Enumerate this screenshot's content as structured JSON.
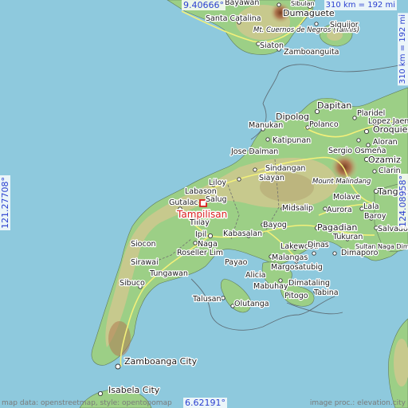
{
  "map": {
    "selected_place": "Tampilisan",
    "coordinates": {
      "top_lat": "9.40666°",
      "bottom_lat": "6.62191°",
      "left_lon": "121.27708°",
      "right_lon": "124.08958°"
    },
    "scale": {
      "horizontal": "310 km = 192 mi",
      "vertical": "310 km = 192 mi"
    },
    "credits": {
      "left": "map data: openstreetmap, style: opentopomap",
      "right": "image proc.: elevation.city"
    },
    "colors": {
      "water": "#8ec9dd",
      "lowland": "#9ccf86",
      "upland": "#c7c98d",
      "highland": "#b07a52",
      "road": "#f3f07a",
      "border": "#6f6f6f",
      "marker": "#d81e1e",
      "coord_text": "#2a3fd0"
    },
    "places": [
      {
        "name": "Bayawan",
        "kind": "town"
      },
      {
        "name": "Sibulan",
        "kind": "town"
      },
      {
        "name": "Dumaguete",
        "kind": "city"
      },
      {
        "name": "Santa Catalina",
        "kind": "town"
      },
      {
        "name": "Mt. Cuernos de Negros (Talinis)",
        "kind": "peak"
      },
      {
        "name": "Siquijor",
        "kind": "town"
      },
      {
        "name": "Siaton",
        "kind": "town"
      },
      {
        "name": "Zamboanguita",
        "kind": "town"
      },
      {
        "name": "Dapitan",
        "kind": "city"
      },
      {
        "name": "Dipolog",
        "kind": "city"
      },
      {
        "name": "Polanco",
        "kind": "town"
      },
      {
        "name": "Plaridel",
        "kind": "town"
      },
      {
        "name": "Lopez Jaena",
        "kind": "town"
      },
      {
        "name": "Oroquieta",
        "kind": "city"
      },
      {
        "name": "Manukan",
        "kind": "town"
      },
      {
        "name": "Katipunan",
        "kind": "town"
      },
      {
        "name": "Sergio Osmeña",
        "kind": "town"
      },
      {
        "name": "Aloran",
        "kind": "town"
      },
      {
        "name": "Jose Dalman",
        "kind": "town"
      },
      {
        "name": "Ozamiz",
        "kind": "city"
      },
      {
        "name": "Clarin",
        "kind": "town"
      },
      {
        "name": "Sindangan",
        "kind": "town"
      },
      {
        "name": "Siayan",
        "kind": "town"
      },
      {
        "name": "Mount Malindang",
        "kind": "peak"
      },
      {
        "name": "Tangub",
        "kind": "city"
      },
      {
        "name": "Liloy",
        "kind": "town"
      },
      {
        "name": "Labason",
        "kind": "town"
      },
      {
        "name": "Salug",
        "kind": "town"
      },
      {
        "name": "Gutalac",
        "kind": "town"
      },
      {
        "name": "Tillay",
        "kind": "town"
      },
      {
        "name": "Midsalip",
        "kind": "town"
      },
      {
        "name": "Molave",
        "kind": "town"
      },
      {
        "name": "Aurora",
        "kind": "town"
      },
      {
        "name": "Lala",
        "kind": "town"
      },
      {
        "name": "Baroy",
        "kind": "town"
      },
      {
        "name": "Bayog",
        "kind": "town"
      },
      {
        "name": "Pagadian",
        "kind": "city"
      },
      {
        "name": "Salvador",
        "kind": "town"
      },
      {
        "name": "Ipil",
        "kind": "town"
      },
      {
        "name": "Kabasalan",
        "kind": "town"
      },
      {
        "name": "Tukuran",
        "kind": "town"
      },
      {
        "name": "Nagа",
        "kind": "town"
      },
      {
        "name": "Siocon",
        "kind": "town"
      },
      {
        "name": "Roseller Lim",
        "kind": "town"
      },
      {
        "name": "Lakewood",
        "kind": "town"
      },
      {
        "name": "Dinas",
        "kind": "town"
      },
      {
        "name": "Dimaporo",
        "kind": "town"
      },
      {
        "name": "Malangas",
        "kind": "town"
      },
      {
        "name": "Margosatubig",
        "kind": "town"
      },
      {
        "name": "Sirawai",
        "kind": "town"
      },
      {
        "name": "Payao",
        "kind": "town"
      },
      {
        "name": "Tungawan",
        "kind": "town"
      },
      {
        "name": "Alicia",
        "kind": "town"
      },
      {
        "name": "Mabuhay",
        "kind": "town"
      },
      {
        "name": "Dimataling",
        "kind": "town"
      },
      {
        "name": "Pitogo",
        "kind": "town"
      },
      {
        "name": "Tabina",
        "kind": "town"
      },
      {
        "name": "Sibuco",
        "kind": "town"
      },
      {
        "name": "Talusan",
        "kind": "town"
      },
      {
        "name": "Olutanga",
        "kind": "town"
      },
      {
        "name": "Zamboanga City",
        "kind": "city"
      },
      {
        "name": "Isabela City",
        "kind": "city"
      },
      {
        "name": "Sultan Naga Dimaporo",
        "kind": "town"
      }
    ]
  }
}
